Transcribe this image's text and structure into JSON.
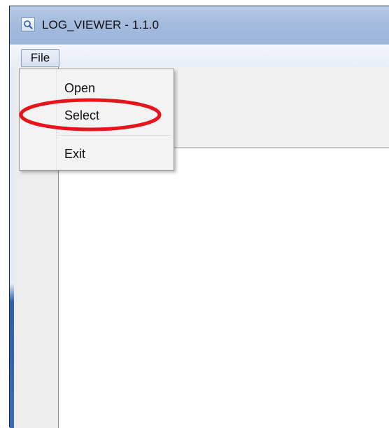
{
  "window": {
    "title": "LOG_VIEWER - 1.1.0",
    "icon": "magnifier-app-icon"
  },
  "menubar": {
    "items": [
      {
        "label": "File"
      }
    ]
  },
  "file_menu": {
    "items": [
      {
        "label": "Open"
      },
      {
        "label": "Select"
      },
      {
        "label": "Exit"
      }
    ]
  },
  "annotation": {
    "highlight_color": "#e8141b",
    "highlighted_item": "Select"
  }
}
